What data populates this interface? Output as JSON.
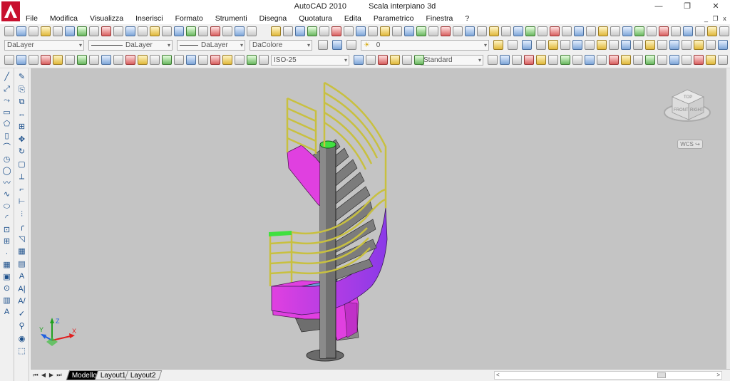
{
  "window": {
    "app_name": "AutoCAD 2010",
    "document_title": "Scala interpiano 3d",
    "controls": {
      "minimize": "—",
      "restore": "❐",
      "close": "✕"
    },
    "doc_controls": {
      "minimize": "_",
      "restore": "❐",
      "close": "x"
    }
  },
  "menu": [
    "File",
    "Modifica",
    "Visualizza",
    "Inserisci",
    "Formato",
    "Strumenti",
    "Disegna",
    "Quotatura",
    "Edita",
    "Parametrico",
    "Finestra",
    "?"
  ],
  "properties_toolbar": {
    "layer": "DaLayer",
    "linetype": "DaLayer",
    "lineweight": "DaLayer",
    "color": "DaColore",
    "current_layer": "0"
  },
  "dimension_toolbar": {
    "dim_style": "ISO-25",
    "text_style": "Standard"
  },
  "viewport": {
    "viewcube_labels": {
      "top": "TOP",
      "front": "FRONT",
      "right": "RIGHT"
    },
    "wcs_label": "WCS ↪",
    "ucs_axes": {
      "x": "X",
      "y": "Y",
      "z": "Z"
    }
  },
  "layout_tabs": [
    {
      "label": "Modello",
      "active": true
    },
    {
      "label": "Layout1",
      "active": false
    },
    {
      "label": "Layout2",
      "active": false
    }
  ],
  "tab_nav": {
    "first": "⏮",
    "prev": "◀",
    "next": "▶",
    "last": "⏭"
  },
  "colors": {
    "viewport_bg": "#c4c4c4",
    "stair_stringer": "#e040e0",
    "stair_underside": "#a040e0",
    "handrail": "#e8e060",
    "column": "#707070",
    "column_top": "#40e040",
    "landing": "#6a9ad8"
  }
}
